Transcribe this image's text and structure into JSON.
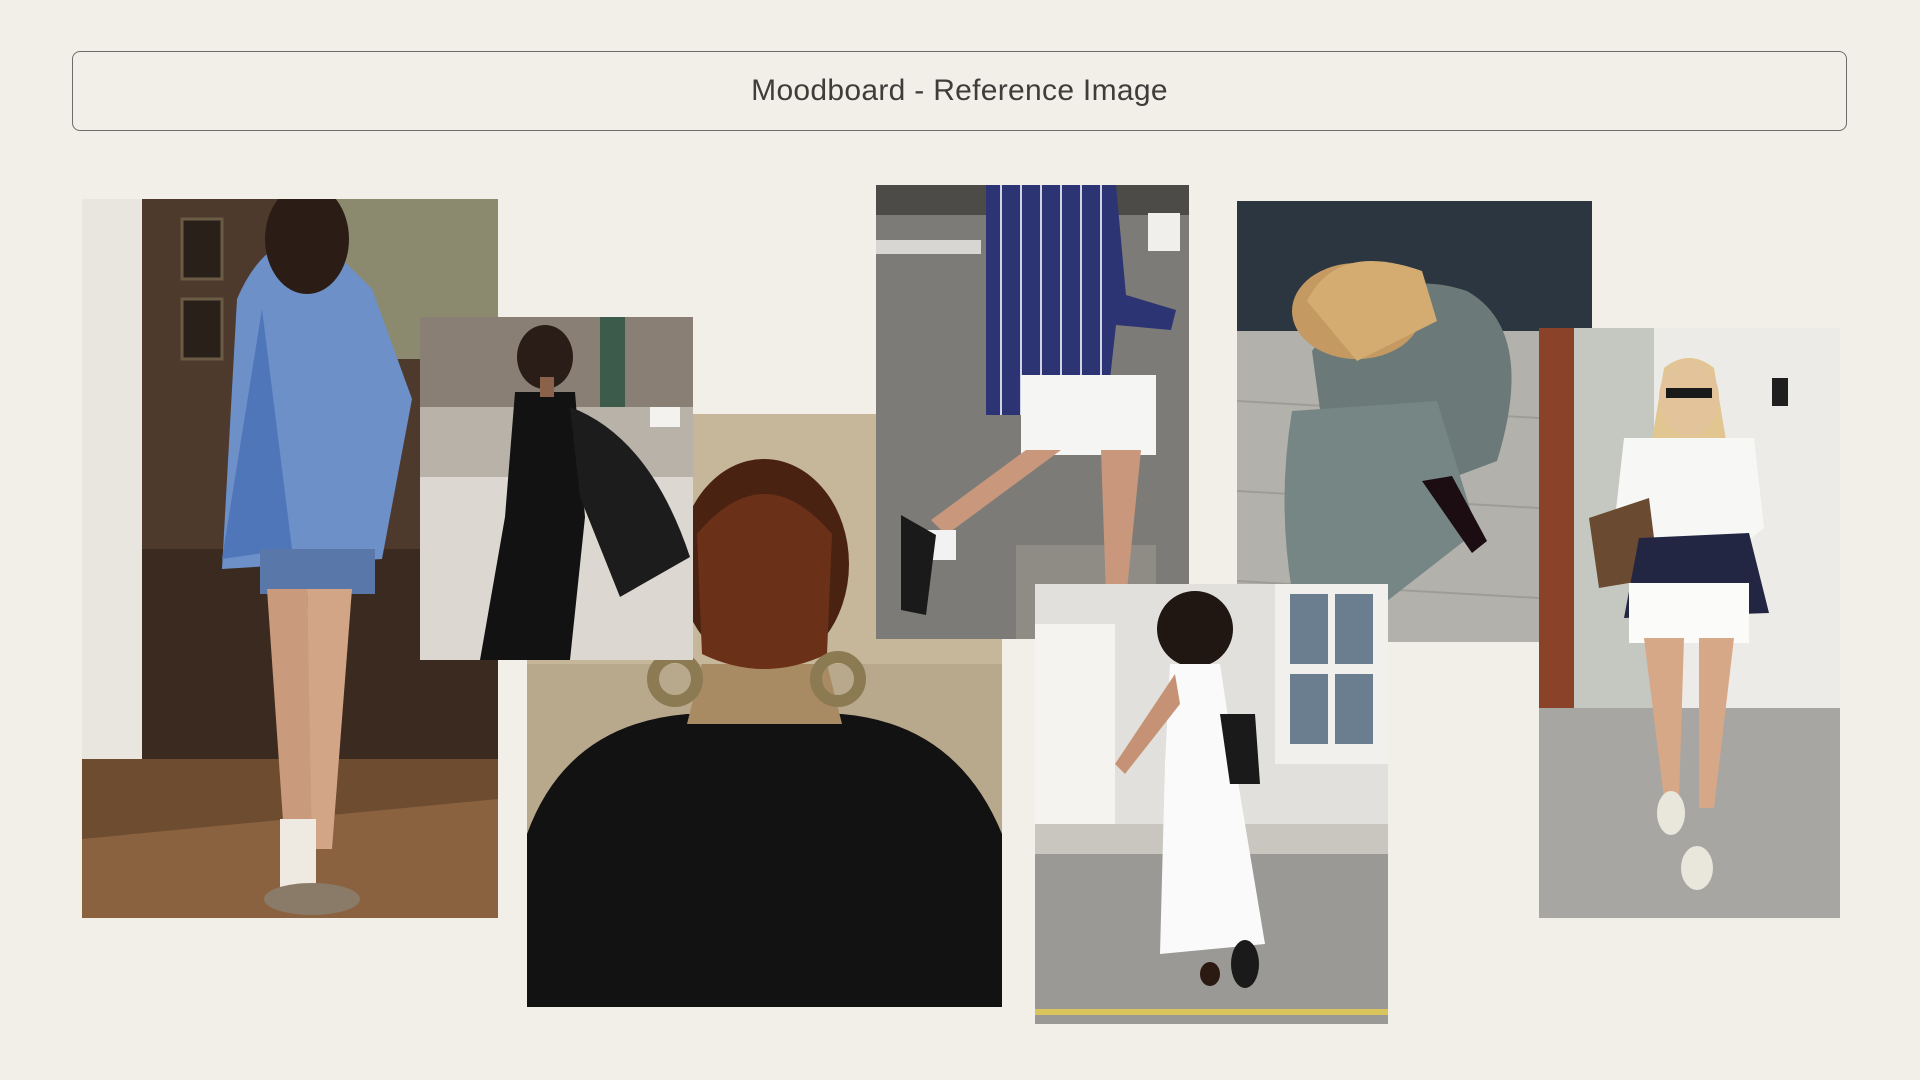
{
  "title": "Moodboard - Reference Image",
  "colors": {
    "background": "#f2efe9",
    "title_border": "#6f6c67",
    "title_text": "#3f3d3a"
  },
  "photos": [
    {
      "name": "photo-blue-shirt-interior",
      "subject": "woman in oversized blue shirt and socks in a cafe interior"
    },
    {
      "name": "photo-black-dress-street",
      "subject": "woman in black slip dress carrying a jacket on a city street"
    },
    {
      "name": "photo-hair-hoop-earrings",
      "subject": "back of head with low bun, hoop earrings and black coat"
    },
    {
      "name": "photo-striped-shirt-sneakers",
      "subject": "person in striped shirt, white skirt and sneakers holding coffee"
    },
    {
      "name": "photo-grey-knit-crouch",
      "subject": "blonde woman in grey knit crouching on pavement"
    },
    {
      "name": "photo-white-maxi-dress",
      "subject": "woman in white maxi dress crossing a street"
    },
    {
      "name": "photo-white-tee-shorts",
      "subject": "blonde woman in white tee, shorts and sweater tied at waist"
    }
  ]
}
